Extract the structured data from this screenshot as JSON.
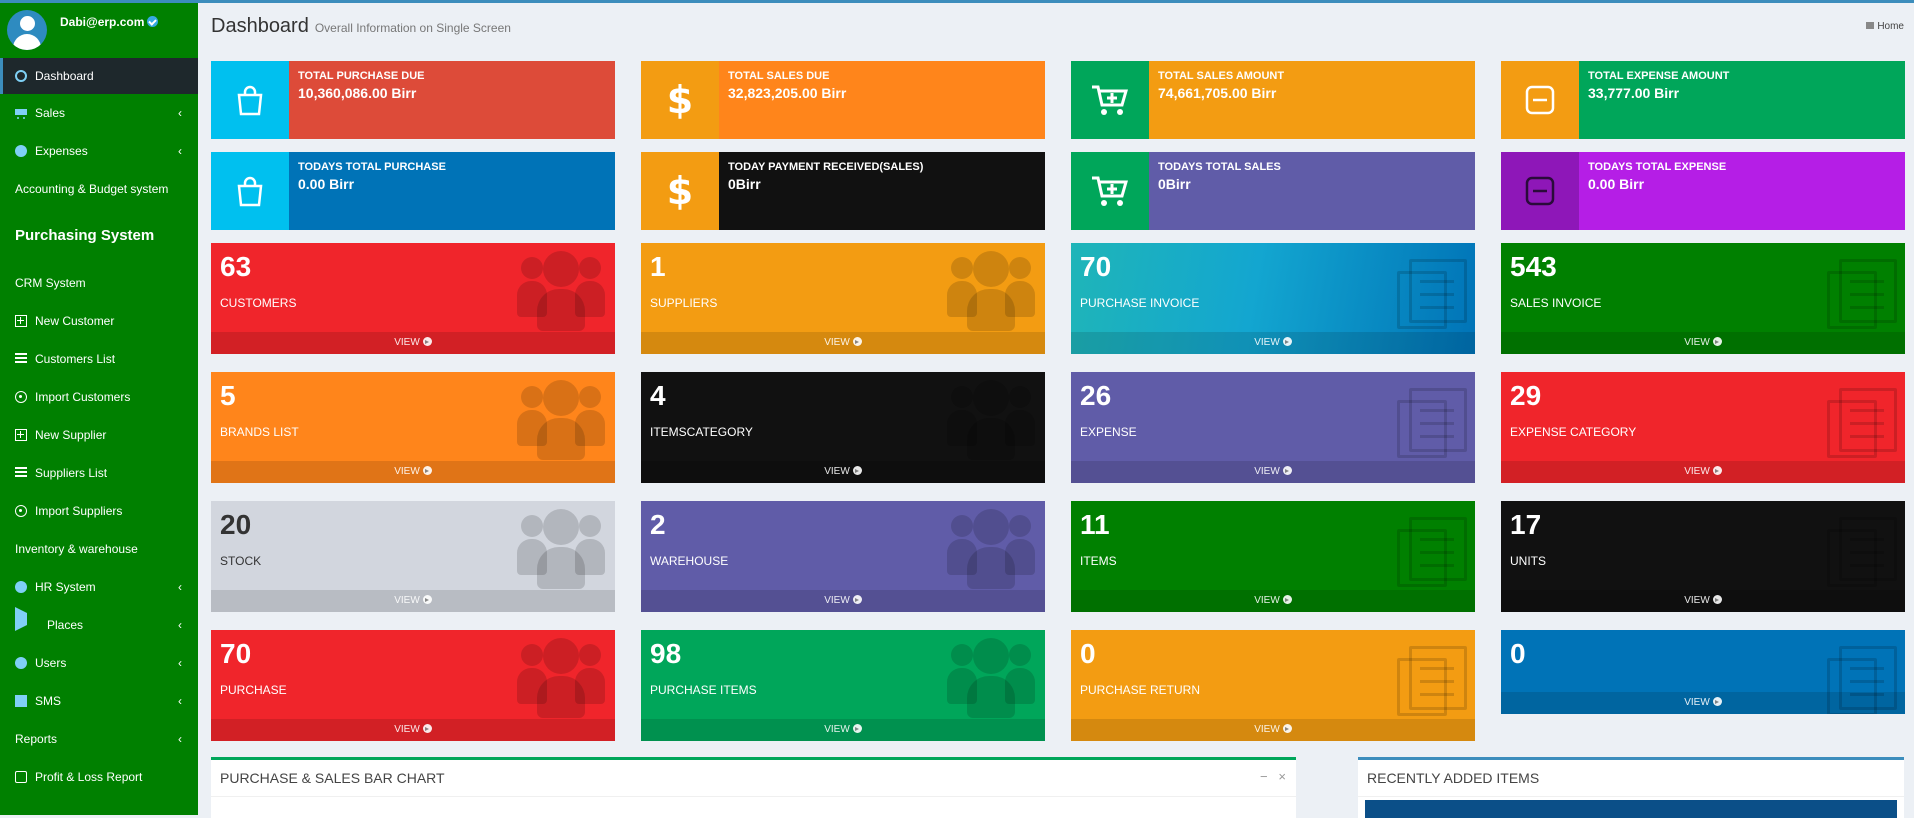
{
  "user": {
    "name": "Dabi@erp.com"
  },
  "sidebar": {
    "items": [
      {
        "label": "Dashboard"
      },
      {
        "label": "Sales"
      },
      {
        "label": "Expenses"
      },
      {
        "label": "Accounting & Budget system"
      },
      {
        "label": "Purchasing System"
      },
      {
        "label": "CRM System"
      },
      {
        "label": "New Customer"
      },
      {
        "label": "Customers List"
      },
      {
        "label": "Import Customers"
      },
      {
        "label": "New Supplier"
      },
      {
        "label": "Suppliers List"
      },
      {
        "label": "Import Suppliers"
      },
      {
        "label": "Inventory & warehouse"
      },
      {
        "label": "HR System"
      },
      {
        "label": "Places"
      },
      {
        "label": "Users"
      },
      {
        "label": "SMS"
      },
      {
        "label": "Reports"
      },
      {
        "label": "Profit & Loss Report"
      }
    ]
  },
  "header": {
    "title": "Dashboard",
    "subtitle": "Overall Information on Single Screen",
    "breadcrumb": "Home"
  },
  "info_boxes": [
    {
      "label": "TOTAL PURCHASE DUE",
      "value": "10,360,086.00 Birr",
      "icon": "shopping-bag-icon",
      "color": "#dd4b39",
      "icon_bg": "#00c0ef"
    },
    {
      "label": "TOTAL SALES DUE",
      "value": "32,823,205.00 Birr",
      "icon": "dollar-icon",
      "color": "#ff851b",
      "icon_bg": "#f39c12"
    },
    {
      "label": "TOTAL SALES AMOUNT",
      "value": "74,661,705.00 Birr",
      "icon": "cart-plus-icon",
      "color": "#f39c12",
      "icon_bg": "#00a65a"
    },
    {
      "label": "TOTAL EXPENSE AMOUNT",
      "value": "33,777.00 Birr",
      "icon": "minus-square-icon",
      "color": "#00a65a",
      "icon_bg": "#f39c12"
    },
    {
      "label": "TODAYS TOTAL PURCHASE",
      "value": "0.00 Birr",
      "icon": "shopping-bag-icon",
      "color": "#0073b7",
      "icon_bg": "#00c0ef"
    },
    {
      "label": "TODAY PAYMENT RECEIVED(SALES)",
      "value": "0Birr",
      "icon": "dollar-icon",
      "color": "#111111",
      "icon_bg": "#f39c12"
    },
    {
      "label": "TODAYS TOTAL SALES",
      "value": "0Birr",
      "icon": "cart-plus-icon",
      "color": "#605ca8",
      "icon_bg": "#00a65a"
    },
    {
      "label": "TODAYS TOTAL EXPENSE",
      "value": "0.00 Birr",
      "icon": "minus-square-icon",
      "color": "#b51ee6",
      "icon_bg": "#8e17b8"
    }
  ],
  "small_boxes": [
    {
      "number": "63",
      "label": "CUSTOMERS",
      "footer": "VIEW",
      "color": "#f0252b",
      "icon": "users-icon"
    },
    {
      "number": "1",
      "label": "SUPPLIERS",
      "footer": "VIEW",
      "color": "#f39c12",
      "icon": "users-icon"
    },
    {
      "number": "70",
      "label": "PURCHASE INVOICE",
      "footer": "VIEW",
      "color": "#00c0ef",
      "icon": "invoice-icon"
    },
    {
      "number": "543",
      "label": "SALES INVOICE",
      "footer": "VIEW",
      "color": "#008000",
      "icon": "invoice-icon"
    },
    {
      "number": "5",
      "label": "BRANDS LIST",
      "footer": "VIEW",
      "color": "#ff851b",
      "icon": "users-icon"
    },
    {
      "number": "4",
      "label": "ITEMSCATEGORY",
      "footer": "VIEW",
      "color": "#111111",
      "icon": "users-icon"
    },
    {
      "number": "26",
      "label": "EXPENSE",
      "footer": "VIEW",
      "color": "#605ca8",
      "icon": "invoice-icon"
    },
    {
      "number": "29",
      "label": "EXPENSE CATEGORY",
      "footer": "VIEW",
      "color": "#f0252b",
      "icon": "invoice-icon"
    },
    {
      "number": "20",
      "label": "STOCK",
      "footer": "VIEW",
      "color": "#d2d6de",
      "icon": "users-icon"
    },
    {
      "number": "2",
      "label": "WAREHOUSE",
      "footer": "VIEW",
      "color": "#605ca8",
      "icon": "users-icon"
    },
    {
      "number": "11",
      "label": "ITEMS",
      "footer": "VIEW",
      "color": "#008000",
      "icon": "invoice-icon"
    },
    {
      "number": "17",
      "label": "UNITS",
      "footer": "VIEW",
      "color": "#111111",
      "icon": "invoice-icon"
    },
    {
      "number": "70",
      "label": "PURCHASE",
      "footer": "VIEW",
      "color": "#f0252b",
      "icon": "users-icon"
    },
    {
      "number": "98",
      "label": "PURCHASE ITEMS",
      "footer": "VIEW",
      "color": "#00a65a",
      "icon": "users-icon"
    },
    {
      "number": "0",
      "label": "PURCHASE RETURN",
      "footer": "VIEW",
      "color": "#f39c12",
      "icon": "invoice-icon"
    },
    {
      "number": "0",
      "label": "",
      "footer": "VIEW",
      "color": "#0073b7",
      "icon": "invoice-icon"
    }
  ],
  "panels": {
    "chart": {
      "title": "PURCHASE & SALES BAR CHART",
      "color": "#00a65a"
    },
    "recent": {
      "title": "RECENTLY ADDED ITEMS",
      "color": "#3c8dbc"
    }
  }
}
